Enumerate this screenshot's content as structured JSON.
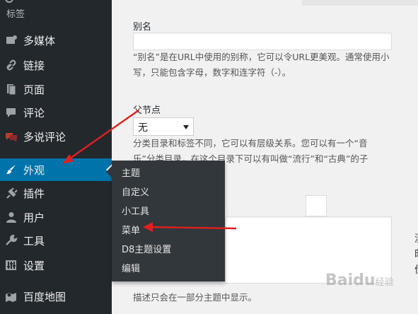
{
  "sidebar": {
    "top_label": "标签",
    "items": [
      {
        "label": "多媒体",
        "icon": "media-icon"
      },
      {
        "label": "链接",
        "icon": "link-icon"
      },
      {
        "label": "页面",
        "icon": "pages-icon"
      },
      {
        "label": "评论",
        "icon": "comment-icon"
      },
      {
        "label": "多说评论",
        "icon": "duoshuo-comment-icon"
      },
      {
        "label": "外观",
        "icon": "appearance-brush-icon"
      },
      {
        "label": "插件",
        "icon": "plugin-icon"
      },
      {
        "label": "用户",
        "icon": "user-icon"
      },
      {
        "label": "工具",
        "icon": "tools-wrench-icon"
      },
      {
        "label": "设置",
        "icon": "settings-sliders-icon"
      },
      {
        "label": "百度地图",
        "icon": "map-icon"
      }
    ],
    "active_color": "#0073aa"
  },
  "flyout": {
    "items": [
      "主题",
      "自定义",
      "小工具",
      "菜单",
      "D8主题设置",
      "编辑"
    ]
  },
  "form": {
    "slug_label": "别名",
    "slug_desc_line1": "“别名”是在URL中使用的别称，它可以令URL更美观。通常使用小",
    "slug_desc_line2": "写，只能包含字母，数字和连字符（-）。",
    "parent_label": "父节点",
    "parent_value": "无",
    "parent_desc_line1": "分类目录和标签不同，它可以有层级关系。您可以有一个“音",
    "parent_desc_line2": "乐”分类目录，在这个目录下可以有叫做“流行”和“古典”的子",
    "description_note": "描述只会在一部分主题中显示。"
  },
  "right_panel": {
    "glyph1": "没",
    "glyph2": "时",
    "glyph3": "份"
  },
  "watermark": {
    "text": "Baidu",
    "sub": "经验"
  },
  "annotation_color": "#e02020"
}
